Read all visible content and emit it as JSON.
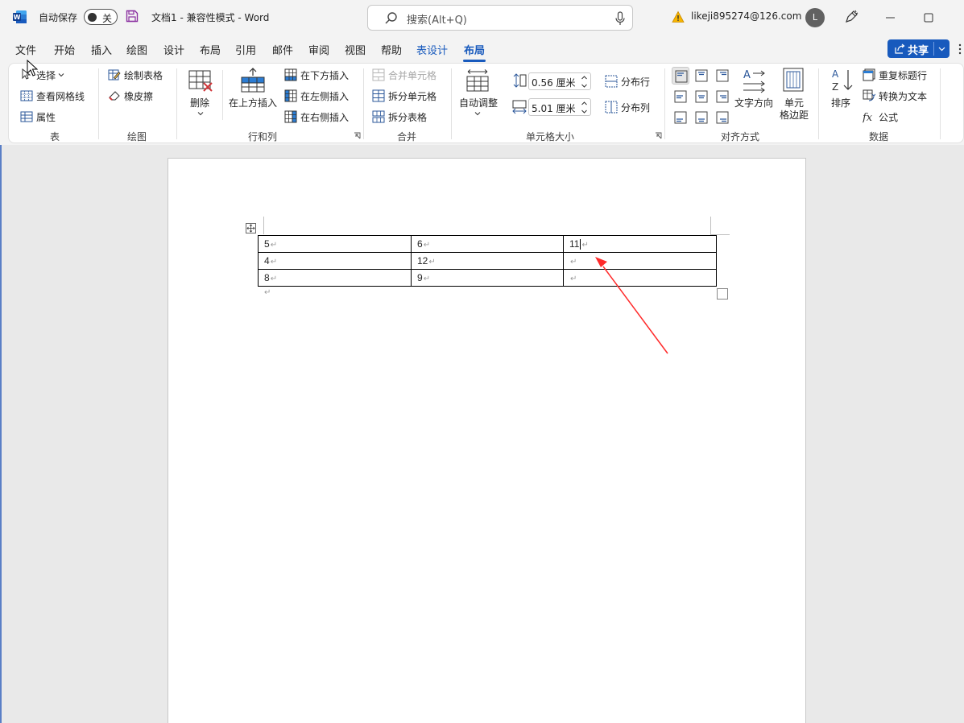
{
  "titlebar": {
    "autosave_label": "自动保存",
    "autosave_state": "关",
    "doc_title": "文档1  -  兼容性模式  -  Word",
    "search_placeholder": "搜索(Alt+Q)",
    "account": "likeji895274@126.com",
    "avatar_initial": "L",
    "brand_color": "#185abd"
  },
  "menu": {
    "tabs": [
      "文件",
      "开始",
      "插入",
      "绘图",
      "设计",
      "布局",
      "引用",
      "邮件",
      "审阅",
      "视图",
      "帮助",
      "表设计",
      "布局"
    ],
    "active_tab": "布局",
    "share_label": "共享"
  },
  "ribbon": {
    "table_group": {
      "label": "表",
      "select": "选择",
      "gridlines": "查看网格线",
      "properties": "属性"
    },
    "draw_group": {
      "label": "绘图",
      "draw_table": "绘制表格",
      "eraser": "橡皮擦"
    },
    "rows_cols_group": {
      "label": "行和列",
      "delete": "删除",
      "insert_above": "在上方插入",
      "insert_below": "在下方插入",
      "insert_left": "在左侧插入",
      "insert_right": "在右侧插入"
    },
    "merge_group": {
      "label": "合并",
      "merge_cells": "合并单元格",
      "split_cells": "拆分单元格",
      "split_table": "拆分表格"
    },
    "cell_size_group": {
      "label": "单元格大小",
      "autofit": "自动调整",
      "height": "0.56 厘米",
      "width": "5.01 厘米",
      "distribute_rows": "分布行",
      "distribute_cols": "分布列"
    },
    "alignment_group": {
      "label": "对齐方式",
      "text_direction": "文字方向",
      "cell_margins_1": "单元",
      "cell_margins_2": "格边距"
    },
    "data_group": {
      "label": "数据",
      "sort": "排序",
      "repeat_header": "重复标题行",
      "convert_text": "转换为文本",
      "formula": "公式"
    }
  },
  "document": {
    "table": [
      [
        "5",
        "6",
        "11"
      ],
      [
        "4",
        "12",
        ""
      ],
      [
        "8",
        "9",
        ""
      ]
    ],
    "annotation_color": "#ff0000"
  }
}
